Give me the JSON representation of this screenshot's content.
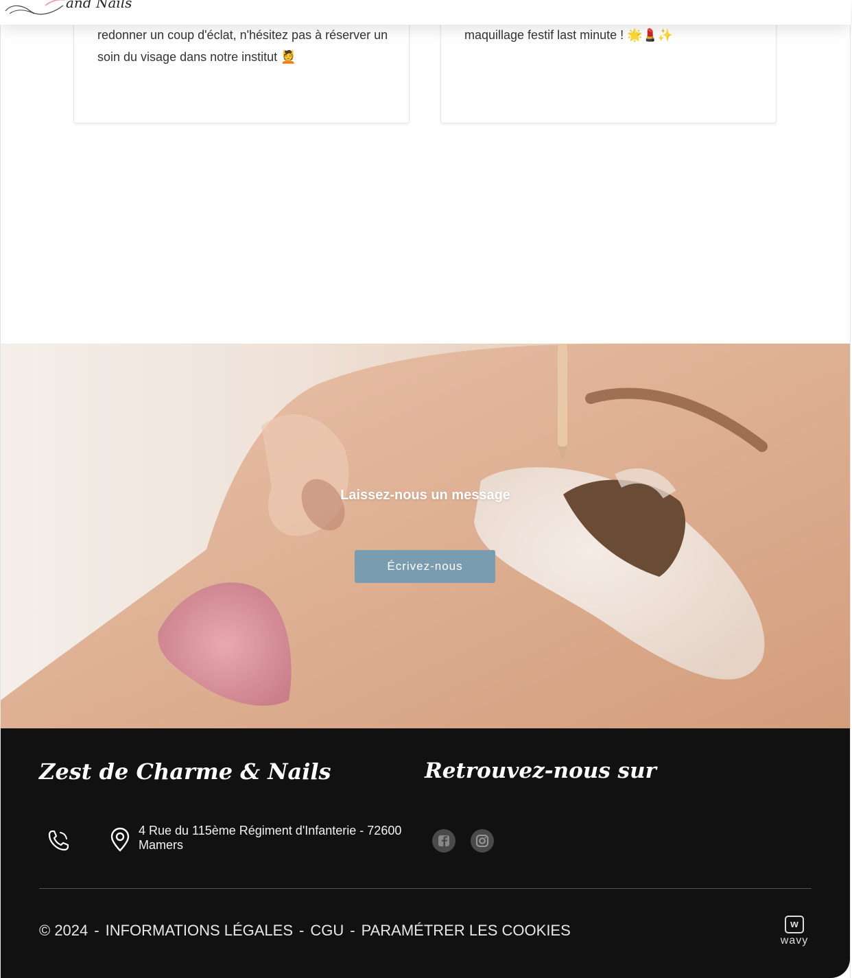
{
  "header": {
    "logo_text": "and Nails"
  },
  "cards": [
    {
      "text": "redonner un coup d'éclat, n'hésitez pas à réserver un soin du visage dans notre institut 💆"
    },
    {
      "text": "maquillage festif last minute ! 🌟💄✨"
    }
  ],
  "hero": {
    "title": "Laissez-nous un message",
    "button_label": "Écrivez-nous"
  },
  "footer": {
    "brand": "Zest de Charme & Nails",
    "social_title": "Retrouvez-nous sur",
    "address": "4 Rue du 115ème Régiment d'Infanterie - 72600 Mamers",
    "social": [
      "facebook-icon",
      "instagram-icon"
    ],
    "legal": {
      "copyright": "© 2024",
      "separator": "-",
      "links": [
        "INFORMATIONS LÉGALES",
        "CGU",
        "PARAMÉTRER LES COOKIES"
      ]
    },
    "wavy_label": "wavy",
    "wavy_mark": "w"
  },
  "colors": {
    "button": "#7a9cb0",
    "footer_bg": "#111111"
  }
}
